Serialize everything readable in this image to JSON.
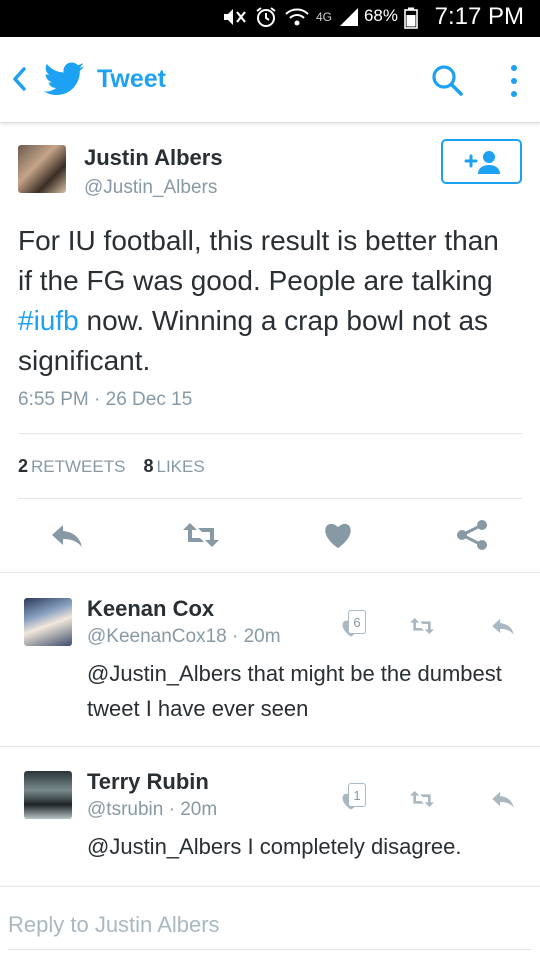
{
  "status_bar": {
    "network": "4G",
    "battery": "68%",
    "time": "7:17 PM"
  },
  "app_bar": {
    "title": "Tweet",
    "icons": [
      "chevron-left-icon",
      "twitter-bird-icon",
      "search-icon",
      "more-vertical-icon"
    ],
    "accent_color": "#1da1f2"
  },
  "tweet": {
    "author_name": "Justin Albers",
    "author_handle": "@Justin_Albers",
    "text_before_hashtag": "For IU football, this result is better than if the FG was good. People are talking ",
    "hashtag": "#iufb",
    "text_after_hashtag": " now. Winning a crap bowl not as significant.",
    "timestamp": "6:55 PM · 26 Dec 15",
    "retweet_count": "2",
    "retweet_label": "RETWEETS",
    "like_count": "8",
    "like_label": "LIKES"
  },
  "replies": [
    {
      "name": "Keenan Cox",
      "handle": "@KeenanCox18",
      "time": "· 20m",
      "text": "@Justin_Albers that might be the dumbest tweet I have ever seen",
      "like_badge": "6"
    },
    {
      "name": "Terry Rubin",
      "handle": "@tsrubin",
      "time": "· 20m",
      "text": "@Justin_Albers I completely disagree.",
      "like_badge": "1"
    }
  ],
  "composer": {
    "placeholder": "Reply to Justin Albers"
  }
}
